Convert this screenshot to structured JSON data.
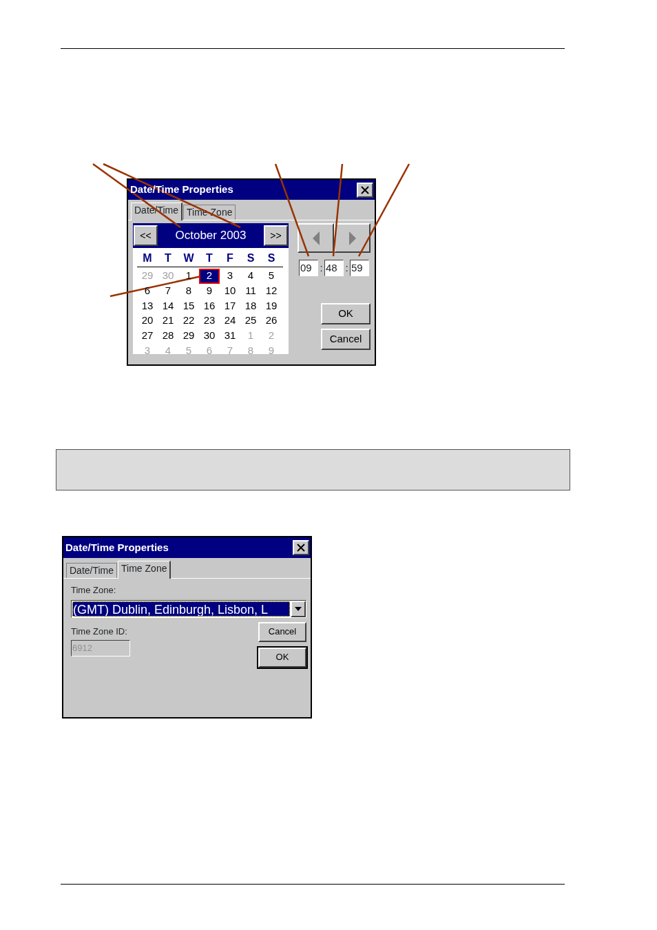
{
  "date_time_dialog": {
    "title": "Date/Time Properties",
    "tabs": [
      {
        "label": "Date/Time",
        "selected": true
      },
      {
        "label": "Time Zone",
        "selected": false
      }
    ],
    "calendar": {
      "prev": "<<",
      "month": "October 2003",
      "next": ">>",
      "weekdays": [
        "M",
        "T",
        "W",
        "T",
        "F",
        "S",
        "S"
      ],
      "weeks": [
        [
          {
            "day": "29",
            "muted": true,
            "selected": false
          },
          {
            "day": "30",
            "muted": true,
            "selected": false
          },
          {
            "day": "1",
            "muted": false,
            "selected": false
          },
          {
            "day": "2",
            "muted": false,
            "selected": true
          },
          {
            "day": "3",
            "muted": false,
            "selected": false
          },
          {
            "day": "4",
            "muted": false,
            "selected": false
          },
          {
            "day": "5",
            "muted": false,
            "selected": false
          }
        ],
        [
          {
            "day": "6",
            "muted": false,
            "selected": false
          },
          {
            "day": "7",
            "muted": false,
            "selected": false
          },
          {
            "day": "8",
            "muted": false,
            "selected": false
          },
          {
            "day": "9",
            "muted": false,
            "selected": false
          },
          {
            "day": "10",
            "muted": false,
            "selected": false
          },
          {
            "day": "11",
            "muted": false,
            "selected": false
          },
          {
            "day": "12",
            "muted": false,
            "selected": false
          }
        ],
        [
          {
            "day": "13",
            "muted": false,
            "selected": false
          },
          {
            "day": "14",
            "muted": false,
            "selected": false
          },
          {
            "day": "15",
            "muted": false,
            "selected": false
          },
          {
            "day": "16",
            "muted": false,
            "selected": false
          },
          {
            "day": "17",
            "muted": false,
            "selected": false
          },
          {
            "day": "18",
            "muted": false,
            "selected": false
          },
          {
            "day": "19",
            "muted": false,
            "selected": false
          }
        ],
        [
          {
            "day": "20",
            "muted": false,
            "selected": false
          },
          {
            "day": "21",
            "muted": false,
            "selected": false
          },
          {
            "day": "22",
            "muted": false,
            "selected": false
          },
          {
            "day": "23",
            "muted": false,
            "selected": false
          },
          {
            "day": "24",
            "muted": false,
            "selected": false
          },
          {
            "day": "25",
            "muted": false,
            "selected": false
          },
          {
            "day": "26",
            "muted": false,
            "selected": false
          }
        ],
        [
          {
            "day": "27",
            "muted": false,
            "selected": false
          },
          {
            "day": "28",
            "muted": false,
            "selected": false
          },
          {
            "day": "29",
            "muted": false,
            "selected": false
          },
          {
            "day": "30",
            "muted": false,
            "selected": false
          },
          {
            "day": "31",
            "muted": false,
            "selected": false
          },
          {
            "day": "1",
            "muted": true,
            "selected": false
          },
          {
            "day": "2",
            "muted": true,
            "selected": false
          }
        ],
        [
          {
            "day": "3",
            "muted": true,
            "selected": false
          },
          {
            "day": "4",
            "muted": true,
            "selected": false
          },
          {
            "day": "5",
            "muted": true,
            "selected": false
          },
          {
            "day": "6",
            "muted": true,
            "selected": false
          },
          {
            "day": "7",
            "muted": true,
            "selected": false
          },
          {
            "day": "8",
            "muted": true,
            "selected": false
          },
          {
            "day": "9",
            "muted": true,
            "selected": false
          }
        ]
      ]
    },
    "spin_buttons": [
      {
        "kind": "left",
        "disabled": true
      },
      {
        "kind": "right",
        "disabled": true
      }
    ],
    "time": {
      "fields": [
        "09",
        "48",
        "59"
      ],
      "separators": [
        ":",
        ":"
      ]
    },
    "buttons": [
      {
        "label": "OK",
        "default": false
      },
      {
        "label": "Cancel",
        "default": false
      }
    ]
  },
  "time_zone_dialog": {
    "title": "Date/Time Properties",
    "tabs": [
      {
        "label": "Date/Time",
        "selected": false
      },
      {
        "label": "Time Zone",
        "selected": true
      }
    ],
    "time_zone_label": "Time Zone:",
    "time_zone_value": "(GMT) Dublin, Edinburgh, Lisbon, L",
    "time_zone_id_label": "Time Zone ID:",
    "time_zone_id_value": "6912",
    "time_zone_id_disabled": true,
    "buttons": [
      {
        "label": "Cancel",
        "default": false
      },
      {
        "label": "OK",
        "default": true
      }
    ]
  }
}
